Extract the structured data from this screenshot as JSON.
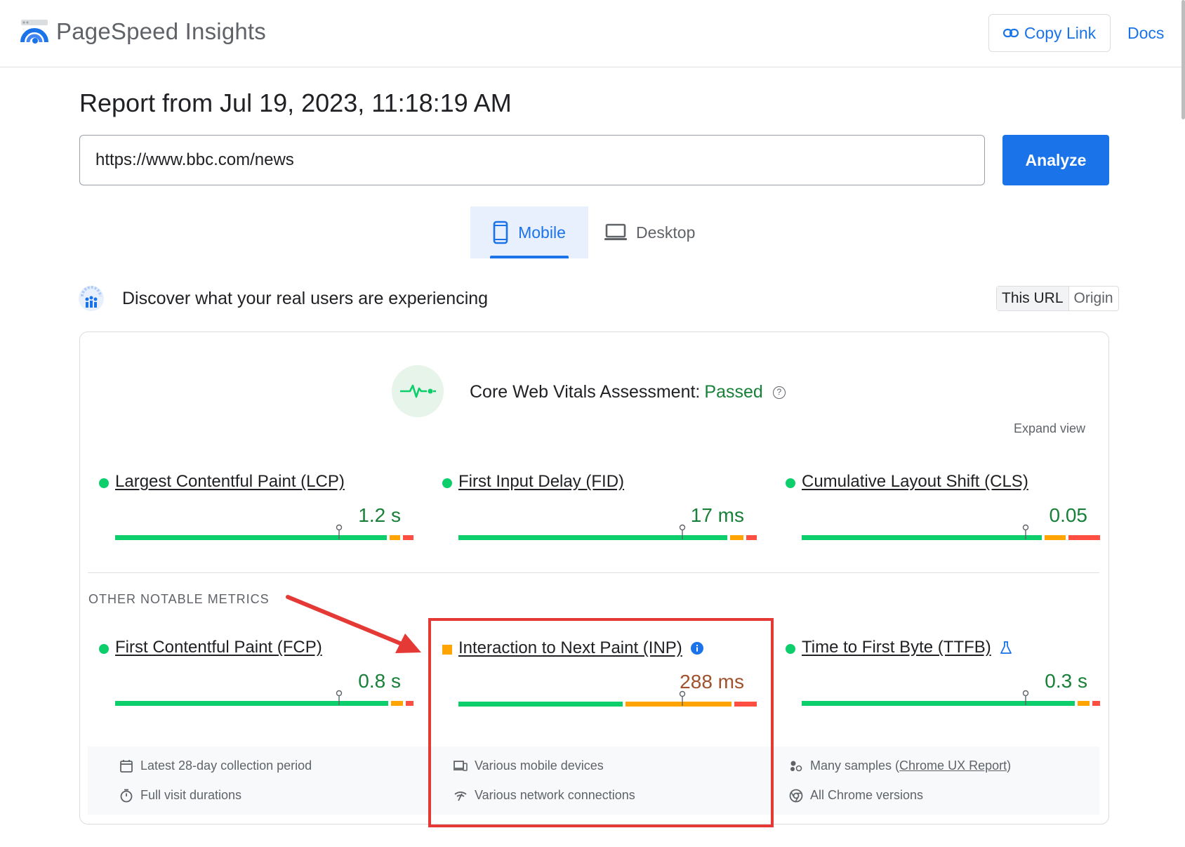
{
  "header": {
    "brand": "PageSpeed Insights",
    "copy_link": "Copy Link",
    "docs": "Docs"
  },
  "report": {
    "title": "Report from Jul 19, 2023, 11:18:19 AM",
    "url_value": "https://www.bbc.com/news",
    "analyze": "Analyze"
  },
  "tabs": {
    "mobile": "Mobile",
    "desktop": "Desktop"
  },
  "discover": {
    "text": "Discover what your real users are experiencing",
    "this_url": "This URL",
    "origin": "Origin"
  },
  "cwv": {
    "label": "Core Web Vitals Assessment:",
    "status": "Passed",
    "expand": "Expand view"
  },
  "metrics": [
    {
      "name": "Largest Contentful Paint (LCP)",
      "value": "1.2 s",
      "rating": "good",
      "distribution": {
        "good": 0.92,
        "needs_improvement": 0.045,
        "poor": 0.035
      },
      "marker": 0.75
    },
    {
      "name": "First Input Delay (FID)",
      "value": "17 ms",
      "rating": "good",
      "distribution": {
        "good": 0.91,
        "needs_improvement": 0.055,
        "poor": 0.035
      },
      "marker": 0.75
    },
    {
      "name": "Cumulative Layout Shift (CLS)",
      "value": "0.05",
      "rating": "good",
      "distribution": {
        "good": 0.815,
        "needs_improvement": 0.08,
        "poor": 0.105
      },
      "marker": 0.75
    }
  ],
  "other_label": "OTHER NOTABLE METRICS",
  "other_metrics": [
    {
      "name": "First Contentful Paint (FCP)",
      "value": "0.8 s",
      "rating": "good",
      "distribution": {
        "good": 0.925,
        "needs_improvement": 0.05,
        "poor": 0.025
      },
      "marker": 0.75
    },
    {
      "name": "Interaction to Next Paint (INP)",
      "value": "288 ms",
      "rating": "needs_improvement",
      "distribution": {
        "good": 0.56,
        "needs_improvement": 0.365,
        "poor": 0.075
      },
      "marker": 0.75
    },
    {
      "name": "Time to First Byte (TTFB)",
      "value": "0.3 s",
      "rating": "good",
      "distribution": {
        "good": 0.925,
        "needs_improvement": 0.05,
        "poor": 0.025
      },
      "marker": 0.75
    }
  ],
  "footer": {
    "period": "Latest 28-day collection period",
    "durations": "Full visit durations",
    "devices": "Various mobile devices",
    "network": "Various network connections",
    "samples_prefix": "Many samples (",
    "samples_link": "Chrome UX Report",
    "samples_suffix": ")",
    "versions": "All Chrome versions"
  },
  "colors": {
    "accent": "#1a73e8",
    "good": "#0cce6b",
    "needs_improvement": "#ffa400",
    "poor": "#ff4e42",
    "annotation": "#e53935"
  }
}
